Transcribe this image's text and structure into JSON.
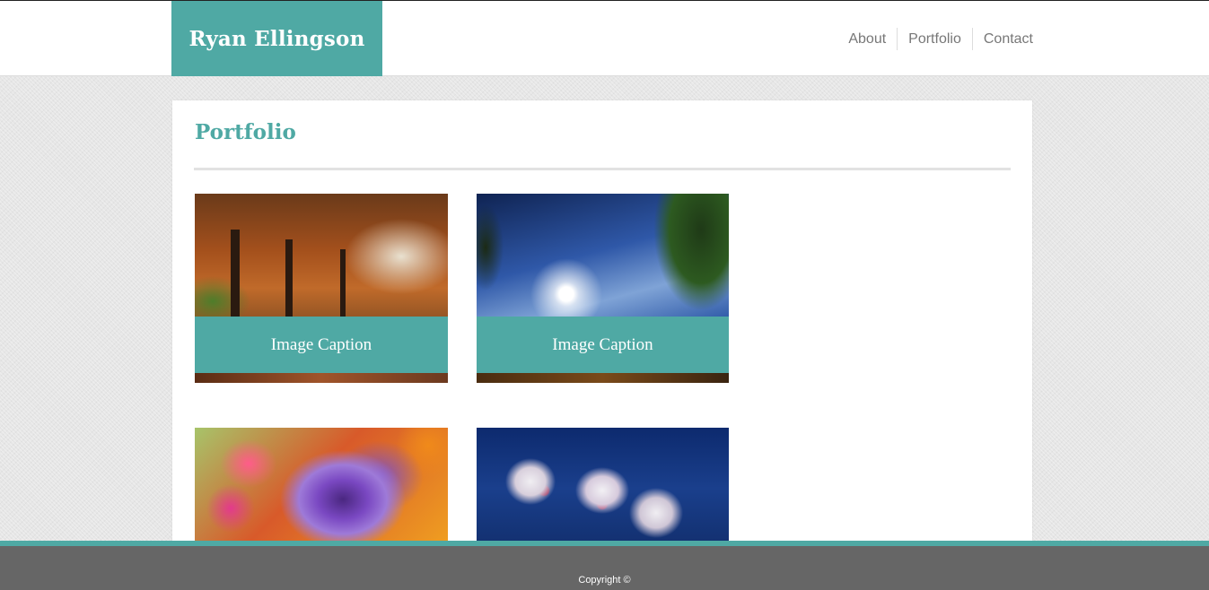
{
  "header": {
    "brand": "Ryan Ellingson",
    "nav": [
      {
        "label": "About"
      },
      {
        "label": "Portfolio"
      },
      {
        "label": "Contact"
      }
    ]
  },
  "main": {
    "title": "Portfolio",
    "gallery": [
      {
        "image": "autumn-trees-image",
        "caption": "Image Caption"
      },
      {
        "image": "sky-palm-image",
        "caption": "Image Caption"
      },
      {
        "image": "pansy-flower-image",
        "caption": ""
      },
      {
        "image": "orchid-image",
        "caption": ""
      }
    ]
  },
  "footer": {
    "copyright": "Copyright ©"
  },
  "colors": {
    "accent": "#4fa9a4",
    "footer": "#666666",
    "nav_text": "#777777"
  }
}
